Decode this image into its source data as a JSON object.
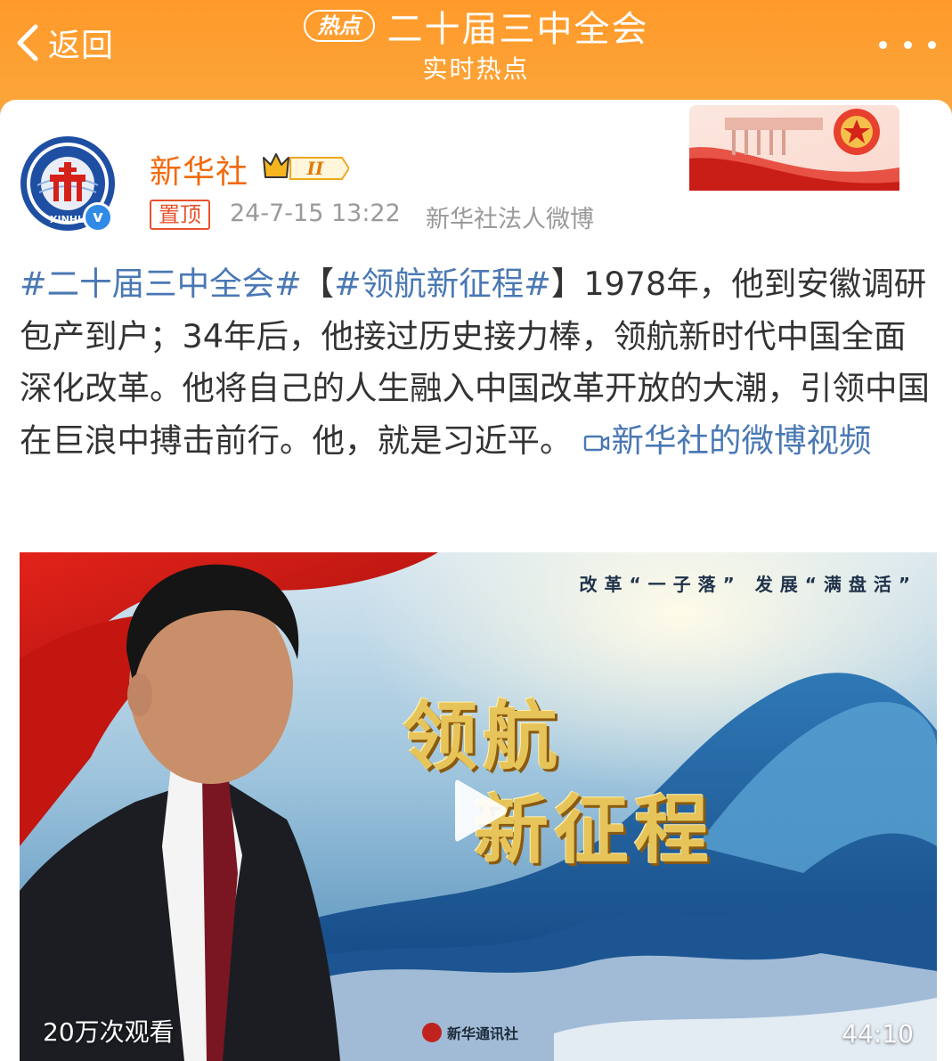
{
  "header": {
    "back_label": "返回",
    "hot_badge": "热点",
    "title": "二十届三中全会",
    "subtitle": "实时热点"
  },
  "post": {
    "author": "新华社",
    "avatar_text": "XINHU",
    "level": "II",
    "pin_label": "置顶",
    "time": "24-7-15 13:22",
    "source": "新华社法人微博",
    "topic1": "#二十届三中全会#",
    "bracket_open": "【",
    "topic2": "#领航新征程#",
    "bracket_close": "】",
    "body": "1978年，他到安徽调研包产到户；34年后，他接过历史接力棒，领航新时代中国全面深化改革。他将自己的人生融入中国改革开放的大潮，引领中国在巨浪中搏击前行。他，就是习近平。",
    "video_link": "新华社的微博视频"
  },
  "video": {
    "caption": "改革“一子落” 发展“满盘活”",
    "title_line1": "领航",
    "title_line2": "新征程",
    "views": "20万次观看",
    "duration": "44:10",
    "watermark": "新华通讯社"
  },
  "colors": {
    "header_orange": "#ff9a2a",
    "author_orange": "#f26a0e",
    "link_blue": "#4a78b4",
    "pin_red": "#e8522d",
    "verified_blue": "#2f8be6"
  }
}
